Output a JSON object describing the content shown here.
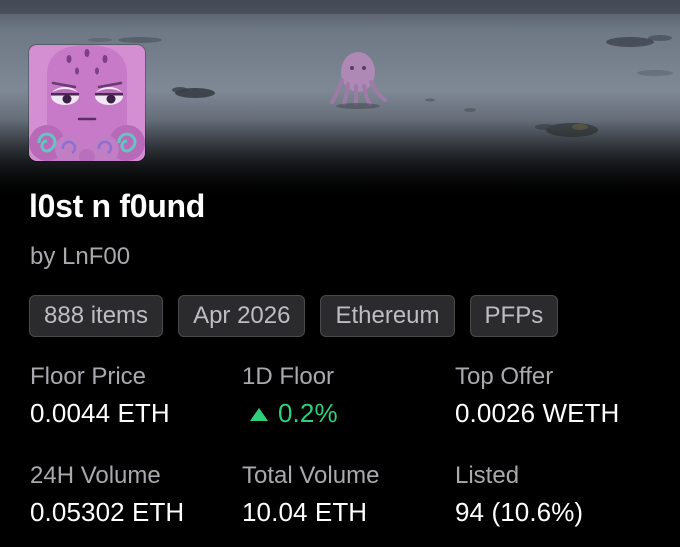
{
  "collection": {
    "name": "l0st n f0und",
    "creator": "by LnF00"
  },
  "tags": [
    "888 items",
    "Apr 2026",
    "Ethereum",
    "PFPs"
  ],
  "stats": {
    "floor_price": {
      "label": "Floor Price",
      "value": "0.0044 ETH"
    },
    "floor_1d": {
      "label": "1D Floor",
      "value": "0.2%",
      "direction": "up"
    },
    "top_offer": {
      "label": "Top Offer",
      "value": "0.0026 WETH"
    },
    "volume_24h": {
      "label": "24H Volume",
      "value": "0.05302 ETH"
    },
    "total_volume": {
      "label": "Total Volume",
      "value": "10.04 ETH"
    },
    "listed": {
      "label": "Listed",
      "value": "94 (10.6%)"
    }
  },
  "colors": {
    "background": "#000000",
    "positive": "#2fd07a",
    "muted_text": "#a9a9ae",
    "tag_bg": "#2b2b2e",
    "avatar_bg": "#d48fd2"
  },
  "icons": {
    "floor_trend": "up-arrow-icon"
  }
}
